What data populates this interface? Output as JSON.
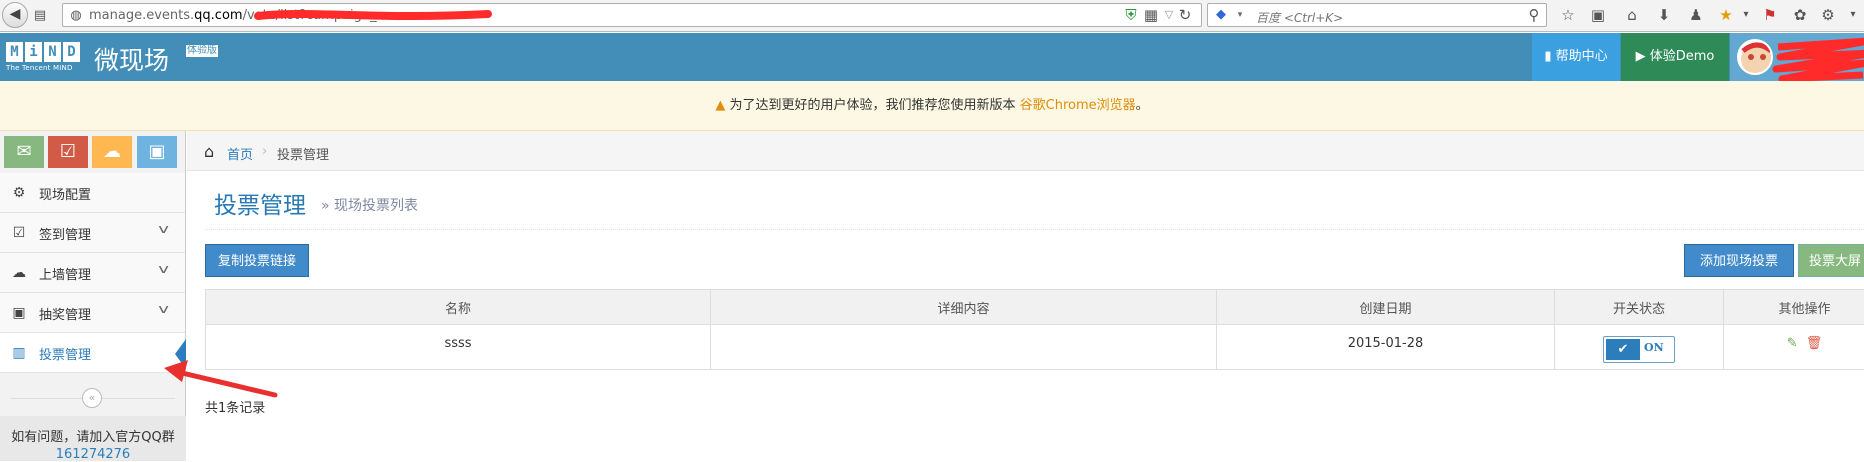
{
  "browser": {
    "url_prefix": "manage.events.",
    "url_domain": "qq.com",
    "url_suffix": "/vote/list?campaign_",
    "search_placeholder": "百度 <Ctrl+K>",
    "icons": [
      "back-icon",
      "page-icon",
      "globe-icon",
      "shield-icon",
      "qr-icon",
      "reload-icon",
      "search-icon",
      "star-icon",
      "reader-icon",
      "home-icon",
      "download-icon",
      "person-icon",
      "badge-icon"
    ]
  },
  "header": {
    "logo_letters": [
      "M",
      "i",
      "N",
      "D"
    ],
    "logo_sub": "The Tencent MIND",
    "brand": "微现场",
    "brand_tag": "体验版",
    "help_label": "帮助中心",
    "demo_label": "体验Demo",
    "colors": {
      "header": "#438eb9",
      "help": "#3aa0e0",
      "demo": "#2e8a57"
    }
  },
  "notice": {
    "text": "为了达到更好的用户体验，我们推荐您使用新版本",
    "link": "谷歌Chrome浏览器",
    "end": "。"
  },
  "sidebar": {
    "shortcuts": [
      {
        "icon": "envelope-icon",
        "color": "#87b87f"
      },
      {
        "icon": "checkbox-icon",
        "color": "#d15b47"
      },
      {
        "icon": "chat-icon",
        "color": "#ffb752"
      },
      {
        "icon": "gift-icon",
        "color": "#6fb3e0"
      }
    ],
    "items": [
      {
        "label": "现场配置",
        "icon": "gear-icon",
        "expandable": false,
        "active": false
      },
      {
        "label": "签到管理",
        "icon": "checkin-icon",
        "expandable": true,
        "active": false
      },
      {
        "label": "上墙管理",
        "icon": "comments-icon",
        "expandable": true,
        "active": false
      },
      {
        "label": "抽奖管理",
        "icon": "gift-icon",
        "expandable": true,
        "active": false
      },
      {
        "label": "投票管理",
        "icon": "bar-chart-icon",
        "expandable": false,
        "active": true
      }
    ],
    "qq_text": "如有问题，请加入官方QQ群",
    "qq_number": "161274276"
  },
  "breadcrumb": {
    "home": "首页",
    "current": "投票管理"
  },
  "page": {
    "title": "投票管理",
    "subtitle": "» 现场投票列表"
  },
  "toolbar": {
    "copy_label": "复制投票链接",
    "add_label": "添加现场投票",
    "screen_label": "投票大屏"
  },
  "table": {
    "headers": [
      "名称",
      "详细内容",
      "创建日期",
      "开关状态",
      "其他操作"
    ],
    "rows": [
      {
        "name": "ssss",
        "detail": "",
        "date": "2015-01-28",
        "status": "ON"
      }
    ]
  },
  "records": "共1条记录"
}
